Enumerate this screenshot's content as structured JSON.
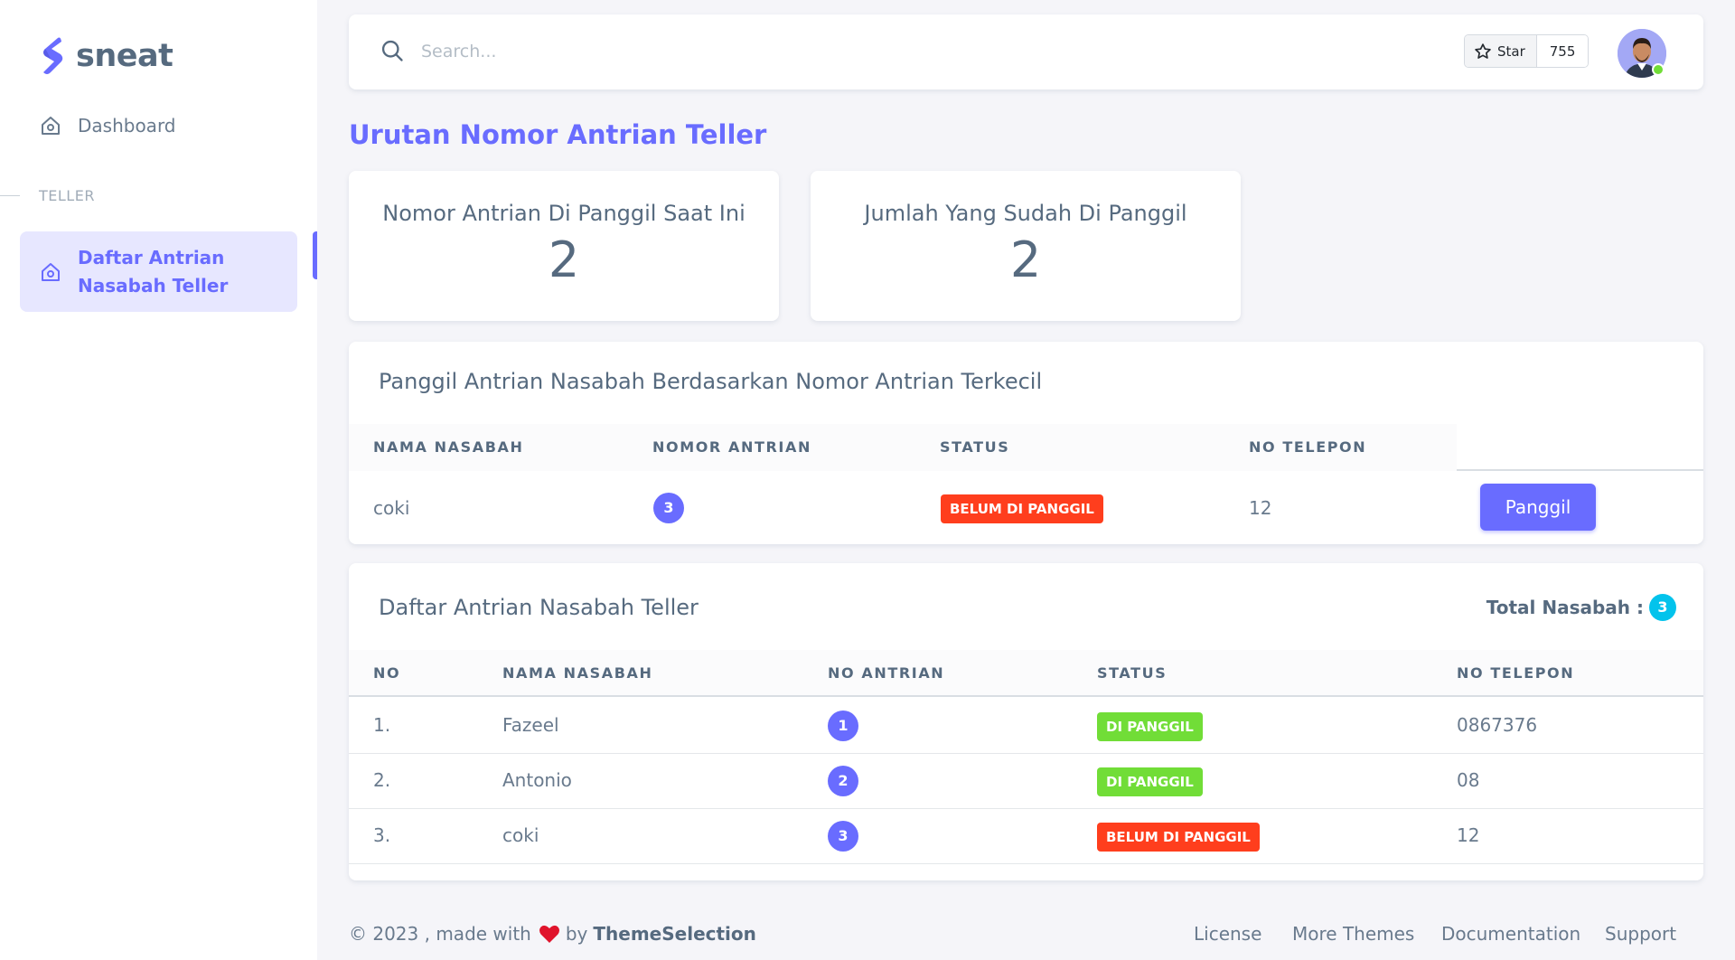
{
  "brand": {
    "name": "sneat"
  },
  "sidebar": {
    "dashboard_label": "Dashboard",
    "section_header": "TELLER",
    "active_item_line1": "Daftar Antrian",
    "active_item_line2": "Nasabah Teller"
  },
  "navbar": {
    "search_placeholder": "Search...",
    "star_label": "Star",
    "star_count": "755"
  },
  "page_title": "Urutan Nomor Antrian Teller",
  "stats": {
    "current_label": "Nomor Antrian Di Panggil Saat Ini",
    "current_value": "2",
    "called_label": "Jumlah Yang Sudah Di Panggil",
    "called_value": "2"
  },
  "call_card": {
    "title": "Panggil Antrian Nasabah Berdasarkan Nomor Antrian Terkecil",
    "columns": [
      "NAMA NASABAH",
      "NOMOR ANTRIAN",
      "STATUS",
      "NO TELEPON"
    ],
    "row": {
      "name": "coki",
      "number": "3",
      "status": "BELUM DI PANGGIL",
      "phone": "12"
    },
    "button_label": "Panggil"
  },
  "list_card": {
    "title": "Daftar Antrian Nasabah Teller",
    "total_label": "Total Nasabah :",
    "total_value": "3",
    "columns": [
      "NO",
      "NAMA NASABAH",
      "NO ANTRIAN",
      "STATUS",
      "NO TELEPON"
    ],
    "rows": [
      {
        "no": "1.",
        "name": "Fazeel",
        "number": "1",
        "status": "DI PANGGIL",
        "phone": "0867376"
      },
      {
        "no": "2.",
        "name": "Antonio",
        "number": "2",
        "status": "DI PANGGIL",
        "phone": "08"
      },
      {
        "no": "3.",
        "name": "coki",
        "number": "3",
        "status": "BELUM DI PANGGIL",
        "phone": "12"
      }
    ]
  },
  "footer": {
    "prefix": "© 2023 , made with",
    "by": "by",
    "brand": "ThemeSelection",
    "links": [
      "License",
      "More Themes",
      "Documentation",
      "Support"
    ]
  },
  "colors": {
    "primary": "#696cff",
    "danger": "#ff3e1d",
    "success": "#71dd37",
    "info": "#03c3ec",
    "heading": "#566a7f",
    "body": "#697a8d",
    "background": "#f5f5f9"
  },
  "icons": {
    "logo": "sneat-logo-icon",
    "dashboard": "home-icon",
    "teller_item": "home-icon",
    "search": "search-icon",
    "star": "star-icon",
    "heart": "heart-icon"
  }
}
